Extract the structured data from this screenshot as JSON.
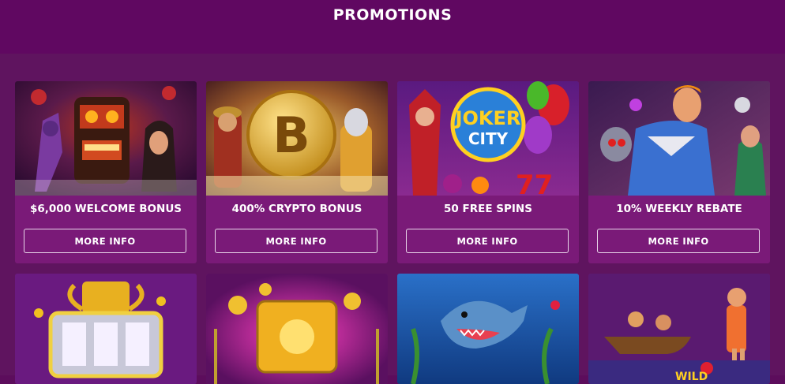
{
  "page": {
    "title": "PROMOTIONS"
  },
  "promotions": [
    {
      "title": "$6,000 WELCOME BONUS",
      "button": "MORE INFO",
      "image_icon": "tiki-mask-icon"
    },
    {
      "title": "400% CRYPTO BONUS",
      "button": "MORE INFO",
      "image_icon": "bitcoin-icon"
    },
    {
      "title": "50 FREE SPINS",
      "button": "MORE INFO",
      "image_icon": "joker-city-icon"
    },
    {
      "title": "10% WEEKLY REBATE",
      "button": "MORE INFO",
      "image_icon": "superhero-icon"
    }
  ],
  "secondary_promotions": [
    {
      "image_icon": "trophy-slot-icon"
    },
    {
      "image_icon": "gold-coins-slot-icon"
    },
    {
      "image_icon": "shark-icon"
    },
    {
      "image_icon": "fishing-boat-icon"
    }
  ],
  "colors": {
    "background": "#5f145f",
    "header": "#600861",
    "card": "#7a1a78",
    "button_border": "#e9d6ea"
  }
}
